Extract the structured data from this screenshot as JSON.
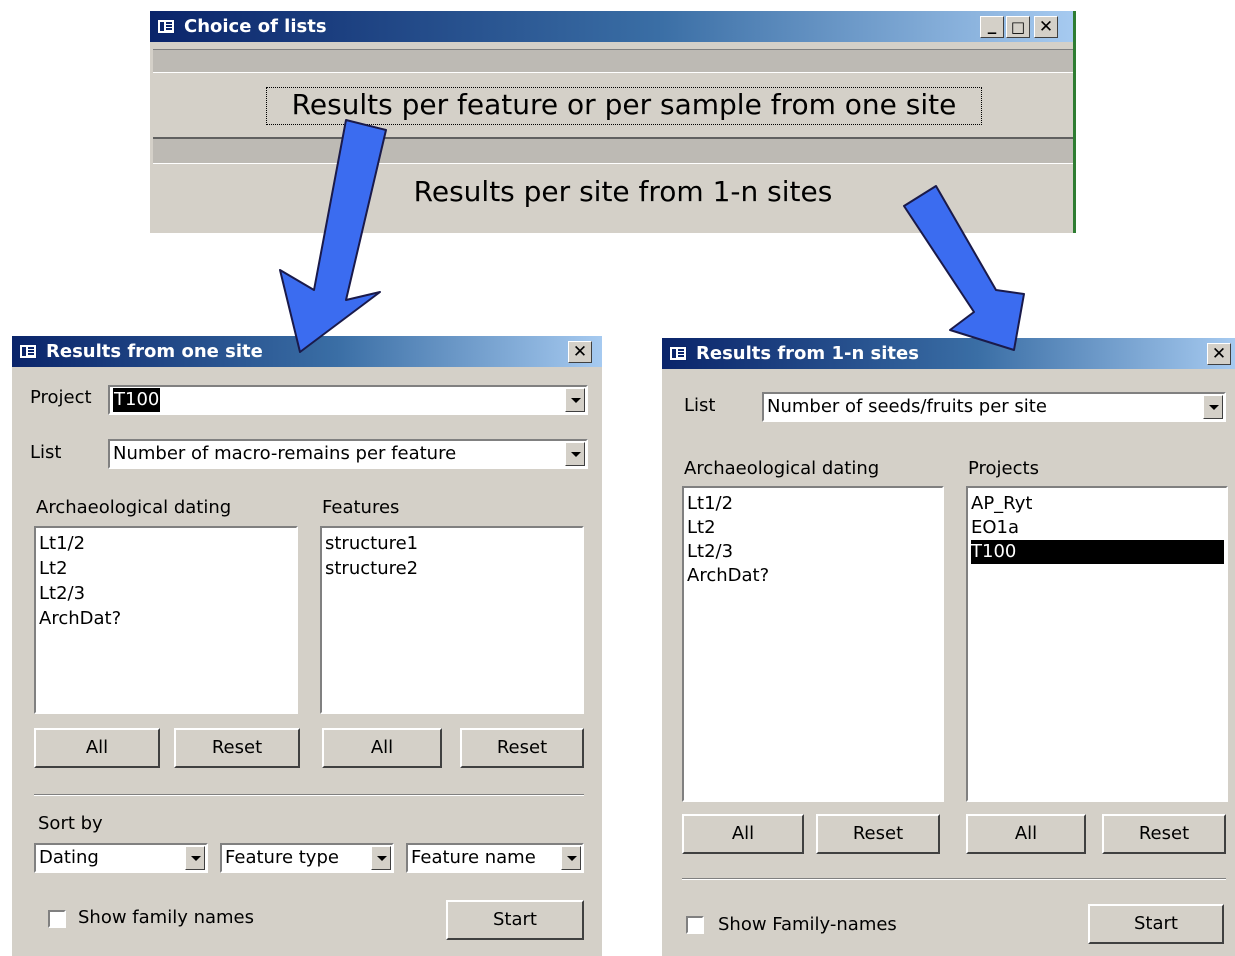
{
  "choice_window": {
    "title": "Choice of lists",
    "btn_min": "_",
    "btn_max": "□",
    "btn_close": "✕",
    "option1": "Results per feature or per sample from one site",
    "option2": "Results per site from 1-n sites"
  },
  "one_site": {
    "title": "Results from one site",
    "close": "✕",
    "project_label": "Project",
    "project_value": "T100",
    "list_label": "List",
    "list_value": "Number of macro-remains per feature",
    "dating_heading": "Archaeological dating",
    "dating_items": [
      "Lt1/2",
      "Lt2",
      "Lt2/3",
      "ArchDat?"
    ],
    "features_heading": "Features",
    "feature_items": [
      "structure1",
      "structure2"
    ],
    "all_label": "All",
    "reset_label": "Reset",
    "sort_label": "Sort by",
    "sort1": "Dating",
    "sort2": "Feature type",
    "sort3": "Feature name",
    "show_label": "Show family names",
    "start_label": "Start"
  },
  "multi_site": {
    "title": "Results from 1-n sites",
    "close": "✕",
    "list_label": "List",
    "list_value": "Number of seeds/fruits per site",
    "dating_heading": "Archaeological dating",
    "dating_items": [
      "Lt1/2",
      "Lt2",
      "Lt2/3",
      "ArchDat?"
    ],
    "projects_heading": "Projects",
    "project_items": [
      "AP_Ryt",
      "EO1a",
      "T100"
    ],
    "all_label": "All",
    "reset_label": "Reset",
    "show_label": "Show Family-names",
    "start_label": "Start"
  },
  "colors": {
    "arrow": "#3b6cf0",
    "window_face": "#d4d0c8",
    "title_dark": "#0a246a",
    "title_light": "#a6caf0"
  }
}
